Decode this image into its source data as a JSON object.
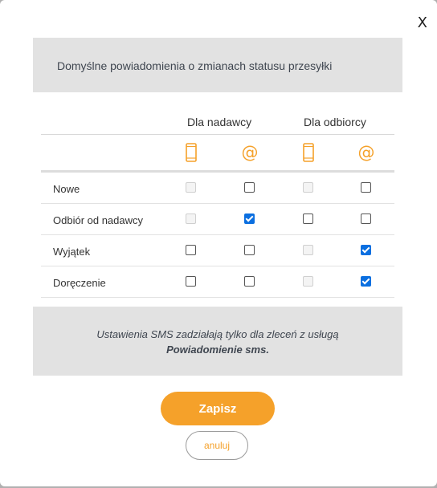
{
  "modal": {
    "close_label": "X",
    "header_title": "Domyślne powiadomienia o zmianach statusu przesyłki",
    "columns": {
      "group_sender": "Dla nadawcy",
      "group_recipient": "Dla odbiorcy",
      "icons": [
        "phone-sms-icon",
        "at-email-icon",
        "phone-sms-icon",
        "at-email-icon"
      ],
      "at_symbol": "@"
    },
    "rows": [
      {
        "label": "Nowe",
        "sender_sms": "disabled",
        "sender_email": "unchecked",
        "recipient_sms": "disabled",
        "recipient_email": "unchecked"
      },
      {
        "label": "Odbiór od nadawcy",
        "sender_sms": "disabled",
        "sender_email": "checked",
        "recipient_sms": "unchecked",
        "recipient_email": "unchecked"
      },
      {
        "label": "Wyjątek",
        "sender_sms": "unchecked",
        "sender_email": "unchecked",
        "recipient_sms": "disabled",
        "recipient_email": "checked"
      },
      {
        "label": "Doręczenie",
        "sender_sms": "unchecked",
        "sender_email": "unchecked",
        "recipient_sms": "disabled",
        "recipient_email": "checked"
      }
    ],
    "note_text": "Ustawienia SMS zadziałają tylko dla zleceń z usługą",
    "note_service": "Powiadomienie sms.",
    "save_label": "Zapisz",
    "cancel_label": "anuluj",
    "colors": {
      "accent": "#f5a12a",
      "checkbox_checked": "#0b6fe0",
      "panel_bg": "#e2e2e2"
    }
  }
}
